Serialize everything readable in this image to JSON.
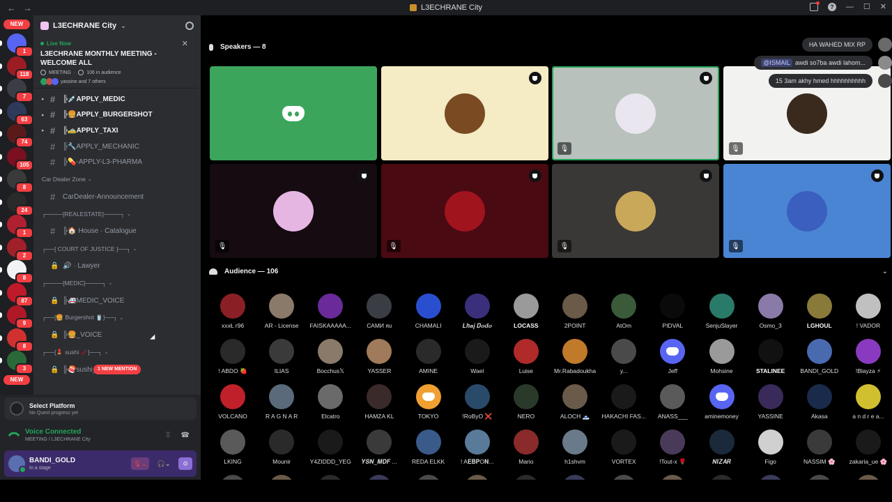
{
  "window": {
    "title": "L3ECHRANE City",
    "nav_back": "←",
    "nav_forward": "→",
    "minimize": "—",
    "maximize": "☐",
    "close": "✕"
  },
  "rail": {
    "new_label": "NEW",
    "badges": [
      "1",
      "118",
      "7",
      "63",
      "74",
      "105",
      "8",
      "24",
      "1",
      "2",
      "8",
      "87",
      "9",
      "8",
      "3"
    ],
    "bottom_new_label": "NEW"
  },
  "guild": {
    "name": "L3ECHRANE City",
    "chevron": "⌄"
  },
  "live": {
    "status": "Live Now",
    "title": "L3ECHRANE MONTHLY MEETING - WELCOME ALL",
    "meta_type": "MEETING",
    "audience": "106 in audience",
    "users_text": "yassine and 7 others",
    "close": "✕"
  },
  "channels": [
    {
      "type": "channel",
      "name": "╠💉APPLY_MEDIC",
      "bold": true,
      "arrow": true
    },
    {
      "type": "channel",
      "name": "╠🍔APPLY_BURGERSHOT",
      "bold": true,
      "arrow": true
    },
    {
      "type": "channel",
      "name": "╠🚕APPLY_TAXI",
      "bold": true,
      "arrow": true
    },
    {
      "type": "channel",
      "name": "╠🔧APPLY_MECHANIC",
      "bold": false,
      "arrow": false
    },
    {
      "type": "channel",
      "name": "╠💊-APPLY-L3-PHARMA",
      "bold": false,
      "arrow": false
    },
    {
      "type": "category",
      "name": "Car Dealer Zone"
    },
    {
      "type": "channel",
      "name": "CarDealer-Announcement",
      "bold": false,
      "arrow": false
    },
    {
      "type": "category",
      "name": "┌────[REALESTATE]────┐"
    },
    {
      "type": "channel",
      "name": "╠🏠 House · Catalogue",
      "bold": false,
      "arrow": false
    },
    {
      "type": "category",
      "name": "┌──[ COURT OF JUSTICE ]──┐"
    },
    {
      "type": "voice",
      "name": "🔊 · Lawyer"
    },
    {
      "type": "category",
      "name": "┌────[MEDIC]────┐"
    },
    {
      "type": "voice",
      "name": "╠🚑MEDIC_VOICE"
    },
    {
      "type": "category",
      "name": "┌──[🍔 Burgershot 🥤]──┐"
    },
    {
      "type": "voice",
      "name": "╠🍔_VOICE"
    },
    {
      "type": "category",
      "name": "┌──[💄 sushi 🥢]──┐"
    },
    {
      "type": "voice",
      "name": "╠🍣sushi_VOICE",
      "mention": "1 NEW MENTION"
    }
  ],
  "quest": {
    "title": "Select Platform",
    "subtitle": "No Quest progress yet"
  },
  "voice": {
    "status": "Voice Connected",
    "location": "MEETING / L3ECHRANE City"
  },
  "user": {
    "name": "BANDI_GOLD",
    "status": "In a stage"
  },
  "stage": {
    "speakers_header": "Speakers — 8",
    "audience_header": "Audience — 106",
    "chat": [
      {
        "text": "HA WAHED MIX RP",
        "mention": ""
      },
      {
        "text": "awdi so7ba awdi lahom...",
        "mention": "@ISMAIL"
      },
      {
        "text": "15 3am akhy hmed hhhhhhhhhh",
        "mention": ""
      }
    ],
    "speakers": [
      {
        "bg": "#3ba55c",
        "discord": true,
        "shield": false,
        "muted": false,
        "speaking": false,
        "av": ""
      },
      {
        "bg": "#f5ebc4",
        "discord": false,
        "shield": true,
        "muted": false,
        "speaking": false,
        "av": "#7a4b22"
      },
      {
        "bg": "#b9c1bd",
        "discord": false,
        "shield": true,
        "muted": true,
        "speaking": true,
        "av": "#e9e6f0"
      },
      {
        "bg": "#f2f2f0",
        "discord": false,
        "shield": false,
        "muted": true,
        "speaking": false,
        "av": "#3a2a1e"
      },
      {
        "bg": "#150b10",
        "discord": false,
        "shield": true,
        "muted": true,
        "speaking": false,
        "av": "#e6b6e3"
      },
      {
        "bg": "#4a0a12",
        "discord": false,
        "shield": true,
        "muted": true,
        "speaking": false,
        "av": "#a0141e"
      },
      {
        "bg": "#3a3836",
        "discord": false,
        "shield": true,
        "muted": true,
        "speaking": false,
        "av": "#c9a85a"
      },
      {
        "bg": "#4a85d4",
        "discord": false,
        "shield": true,
        "muted": true,
        "speaking": false,
        "av": "#3b5fbf"
      }
    ],
    "audience": [
      {
        "name": "xxxŁ r96",
        "bold": false,
        "color": "#8a2026"
      },
      {
        "name": "AR - License",
        "bold": false,
        "color": "#8a7a6a"
      },
      {
        "name": "FAISKAAAAA...",
        "bold": false,
        "color": "#6a2a9a"
      },
      {
        "name": "САМИ ᴙᴜ",
        "bold": false,
        "color": "#3a3e44"
      },
      {
        "name": "CHAMALI",
        "bold": false,
        "color": "#2a4ed0"
      },
      {
        "name": "𝑳𝒉𝒂𝒋 𝑫𝒐𝒅𝒐",
        "bold": false,
        "color": "#3a2f7a"
      },
      {
        "name": "LOCASS",
        "bold": true,
        "color": "#9a9a9a"
      },
      {
        "name": "2POINT",
        "bold": false,
        "color": "#6a5a48"
      },
      {
        "name": "AtOm",
        "bold": false,
        "color": "#3a5a3a"
      },
      {
        "name": "PIDVAL",
        "bold": false,
        "color": "#0a0a0a"
      },
      {
        "name": "SenjuSlayer",
        "bold": false,
        "color": "#2a7a6a"
      },
      {
        "name": "Osmo_3",
        "bold": false,
        "color": "#8a7aa8"
      },
      {
        "name": "LGHOUL",
        "bold": true,
        "color": "#8a7a3a"
      },
      {
        "name": "! VADOR",
        "bold": false,
        "color": "#c0c0c0"
      },
      {
        "name": "! ABDO 🍓",
        "bold": false,
        "color": "#2a2a2a"
      },
      {
        "name": "ILIAS",
        "bold": false,
        "color": "#3a3a3a"
      },
      {
        "name": "Bocchus𝕏",
        "bold": false,
        "color": "#8a7a6a"
      },
      {
        "name": "YASSER",
        "bold": false,
        "color": "#a07a5a"
      },
      {
        "name": "AMINE",
        "bold": false,
        "color": "#2a2a2a"
      },
      {
        "name": "Wael",
        "bold": false,
        "color": "#1a1a1a"
      },
      {
        "name": "Luise",
        "bold": false,
        "color": "#b02a2a"
      },
      {
        "name": "Mr.Rabadoukha",
        "bold": false,
        "color": "#c07a2a"
      },
      {
        "name": "y...",
        "bold": false,
        "color": "#4a4a4a"
      },
      {
        "name": "Jeff",
        "bold": false,
        "color": "#5865f2",
        "discord": true
      },
      {
        "name": "Mohsine",
        "bold": false,
        "color": "#9a9a9a"
      },
      {
        "name": "STALINEE",
        "bold": true,
        "color": "#111"
      },
      {
        "name": "BANDI_GOLD",
        "bold": false,
        "color": "#4a6ab0"
      },
      {
        "name": "!Blayza ⚡",
        "bold": false,
        "color": "#8a3ac0"
      },
      {
        "name": "VOLCANO",
        "bold": false,
        "color": "#c0202a"
      },
      {
        "name": "R A G N A R",
        "bold": false,
        "color": "#5a6a7a"
      },
      {
        "name": "Elcatro",
        "bold": false,
        "color": "#6a6a6a"
      },
      {
        "name": "HAMZA KL",
        "bold": false,
        "color": "#3a2a2a"
      },
      {
        "name": "TOKYO",
        "bold": false,
        "color": "#f0a030",
        "discord": true
      },
      {
        "name": "!RoByO ❌",
        "bold": false,
        "color": "#2a4a6a"
      },
      {
        "name": "NERO",
        "bold": false,
        "color": "#2a3a2a"
      },
      {
        "name": "ALOCH 🗻",
        "bold": false,
        "color": "#6a5a4a"
      },
      {
        "name": "HAKACHI FAS...",
        "bold": false,
        "color": "#1a1a1a"
      },
      {
        "name": "ANASS___",
        "bold": false,
        "color": "#5a5a5a"
      },
      {
        "name": "aminemoney",
        "bold": false,
        "color": "#5865f2",
        "discord": true
      },
      {
        "name": "YASSINE",
        "bold": false,
        "color": "#3a2a5a"
      },
      {
        "name": "Akasa",
        "bold": false,
        "color": "#1a2a4a"
      },
      {
        "name": "a n d r e a...",
        "bold": false,
        "color": "#d0c030"
      },
      {
        "name": "LKING",
        "bold": false,
        "color": "#5a5a5a"
      },
      {
        "name": "Mounir",
        "bold": false,
        "color": "#2a2a2a"
      },
      {
        "name": "Y4ZIDDD_YEG",
        "bold": false,
        "color": "#1a1a1a"
      },
      {
        "name": "𝒀𝑺𝑵_𝑴𝑫𝑭 ...",
        "bold": false,
        "color": "#3a3a3a"
      },
      {
        "name": "REDA ELKK",
        "bold": false,
        "color": "#3a5a8a"
      },
      {
        "name": "! A𝐄𝐁𝐏O𝐍...",
        "bold": false,
        "color": "#5a7a9a"
      },
      {
        "name": "Mario",
        "bold": false,
        "color": "#8a2a2a"
      },
      {
        "name": "h1shvm",
        "bold": false,
        "color": "#6a7a8a"
      },
      {
        "name": "VORTEX",
        "bold": false,
        "color": "#1a1a1a"
      },
      {
        "name": "!Tout-x 🌹",
        "bold": false,
        "color": "#4a3a5a"
      },
      {
        "name": "𝑵𝑰𝒁𝑨𝑹",
        "bold": false,
        "color": "#1a2a3a"
      },
      {
        "name": "Figo",
        "bold": false,
        "color": "#d0d0d0"
      },
      {
        "name": "NASSIM 🌸",
        "bold": false,
        "color": "#3a3a3a"
      },
      {
        "name": "zakaria_ue 🌸",
        "bold": false,
        "color": "#1a1a1a"
      }
    ]
  }
}
